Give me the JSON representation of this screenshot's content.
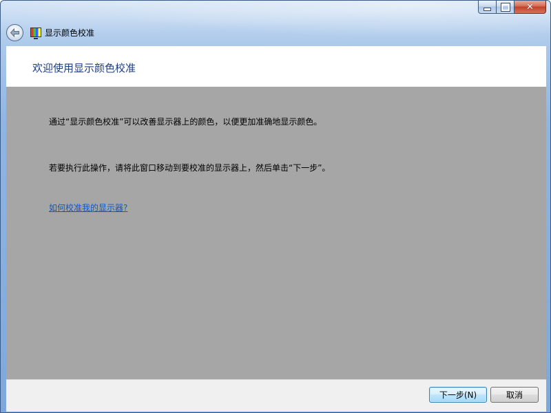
{
  "window": {
    "title": "显示颜色校准",
    "caption_buttons": {
      "minimize_icon": "minimize-icon",
      "maximize_icon": "maximize-icon",
      "close_icon": "close-icon",
      "close_glyph": "✕"
    }
  },
  "nav": {
    "back_icon": "back-arrow-icon",
    "app_icon": "display-color-icon"
  },
  "page": {
    "heading": "欢迎使用显示颜色校准",
    "paragraph_1": "通过“显示颜色校准”可以改善显示器上的颜色，以便更加准确地显示颜色。",
    "paragraph_2": "若要执行此操作，请将此窗口移动到要校准的显示器上，然后单击“下一步”。",
    "help_link": "如何校准我的显示器?"
  },
  "footer": {
    "next_label": "下一步(N)",
    "cancel_label": "取消"
  },
  "colors": {
    "heading": "#1e3d87",
    "link": "#0f57c7",
    "body_background": "#a6a6a6",
    "footer_background": "#f0f0f0"
  }
}
